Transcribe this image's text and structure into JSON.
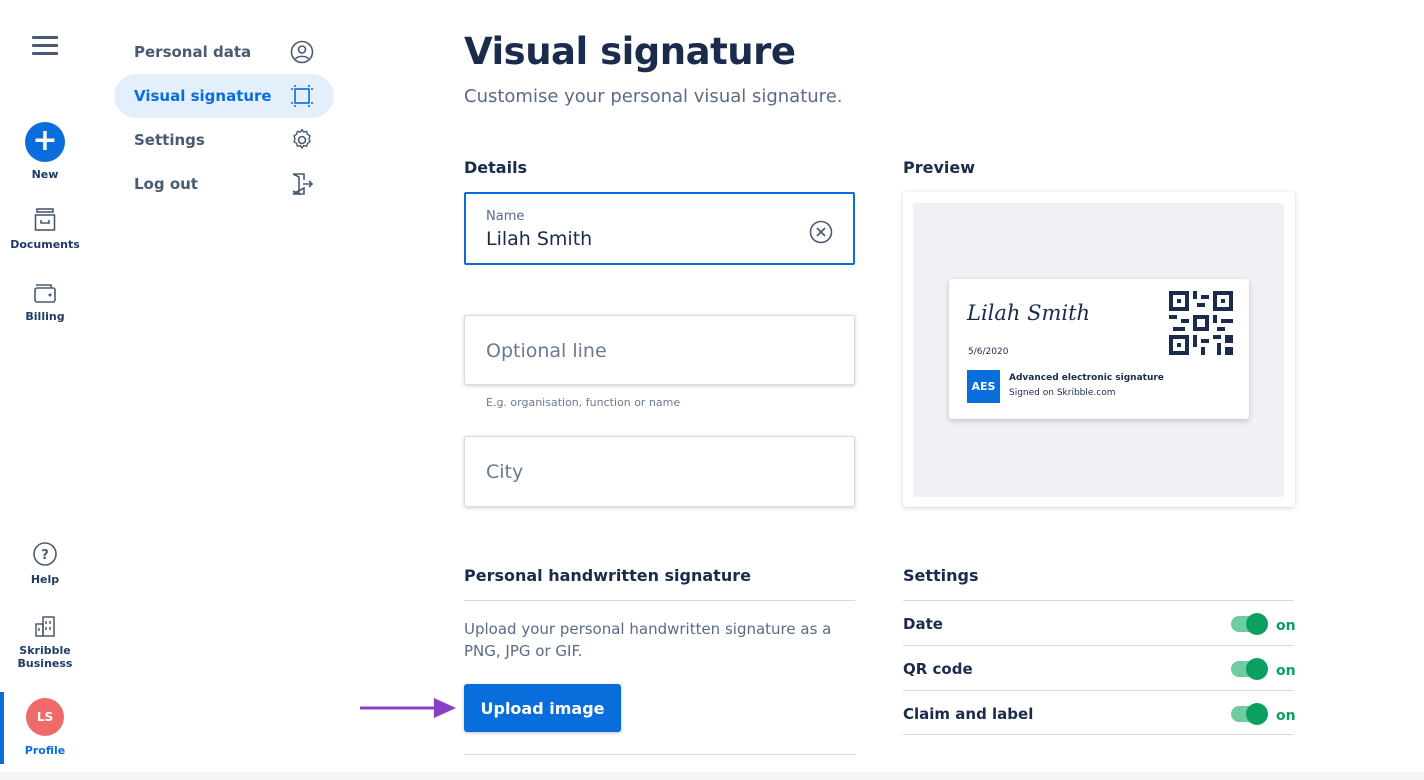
{
  "rail": {
    "new_label": "New",
    "documents_label": "Documents",
    "billing_label": "Billing",
    "help_label": "Help",
    "business_label_1": "Skribble",
    "business_label_2": "Business",
    "avatar_initials": "LS",
    "profile_label": "Profile",
    "new_glyph": "+",
    "accent_color": "#0a6ddc",
    "avatar_color": "#f16a6a"
  },
  "subnav": {
    "items": [
      {
        "label": "Personal data",
        "icon": "user-circle-icon"
      },
      {
        "label": "Visual signature",
        "icon": "crop-frame-icon",
        "active": true
      },
      {
        "label": "Settings",
        "icon": "gear-icon"
      },
      {
        "label": "Log out",
        "icon": "logout-door-icon"
      }
    ]
  },
  "main": {
    "title": "Visual signature",
    "subtitle": "Customise your personal visual signature."
  },
  "details": {
    "heading": "Details",
    "name_label": "Name",
    "name_value": "Lilah Smith",
    "optional_placeholder": "Optional line",
    "optional_hint": "E.g. organisation, function or name",
    "city_placeholder": "City"
  },
  "preview": {
    "heading": "Preview",
    "sig_name": "Lilah Smith",
    "sig_date": "5/6/2020",
    "badge": "AES",
    "badge_title": "Advanced electronic signature",
    "badge_sub": "Signed on Skribble.com"
  },
  "handwritten": {
    "heading": "Personal handwritten signature",
    "description": "Upload your personal handwritten signature as a PNG, JPG or GIF.",
    "upload_label": "Upload image",
    "arrow_color": "#8a3fc8"
  },
  "settings": {
    "heading": "Settings",
    "rows": [
      {
        "label": "Date",
        "state": "on"
      },
      {
        "label": "QR code",
        "state": "on"
      },
      {
        "label": "Claim and label",
        "state": "on"
      }
    ],
    "on_color": "#0ca060"
  }
}
